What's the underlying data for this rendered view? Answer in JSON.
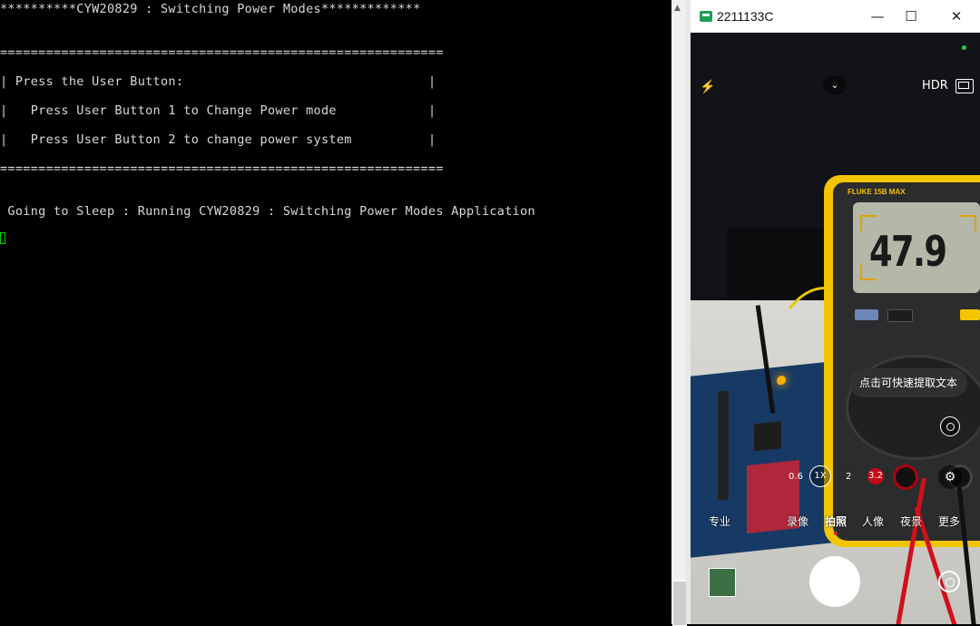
{
  "terminal": {
    "lines": [
      "**********CYW20829 : Switching Power Modes*************",
      "==========================================================",
      "| Press the User Button:                                |",
      "|   Press User Button 1 to Change Power mode            |",
      "|   Press User Button 2 to change power system          |",
      "==========================================================",
      " Going to Sleep : Running CYW20829 : Switching Power Modes Application"
    ]
  },
  "phone_window": {
    "title": "2211133C",
    "controls": {
      "minimize": "—",
      "maximize": "☐",
      "close": "✕"
    }
  },
  "camera": {
    "hdr_label": "HDR",
    "tooltip": "点击可快速提取文本",
    "zoom_levels": [
      "0.6",
      "1X",
      "2",
      "3.2"
    ],
    "modes": [
      "专业",
      "录像",
      "拍照",
      "人像",
      "夜景",
      "更多"
    ],
    "active_mode": "拍照",
    "meter": {
      "brand": "FLUKE 15B MAX",
      "reading": "47.9"
    }
  }
}
